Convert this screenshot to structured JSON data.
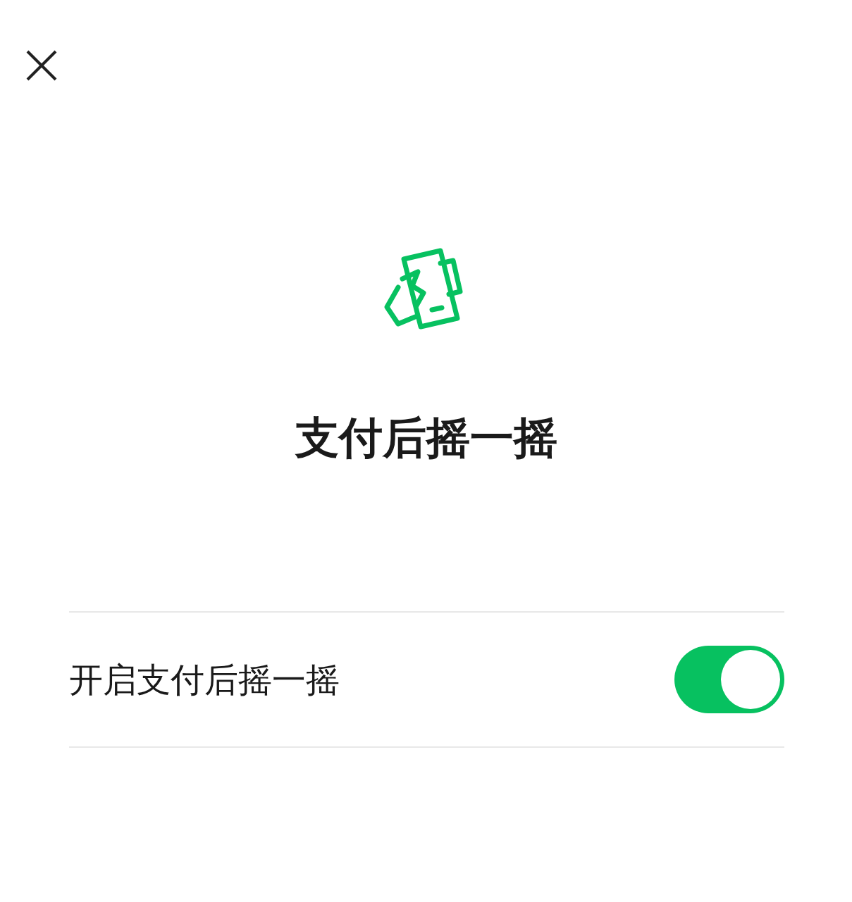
{
  "title": "支付后摇一摇",
  "setting": {
    "label": "开启支付后摇一摇",
    "on": true
  }
}
